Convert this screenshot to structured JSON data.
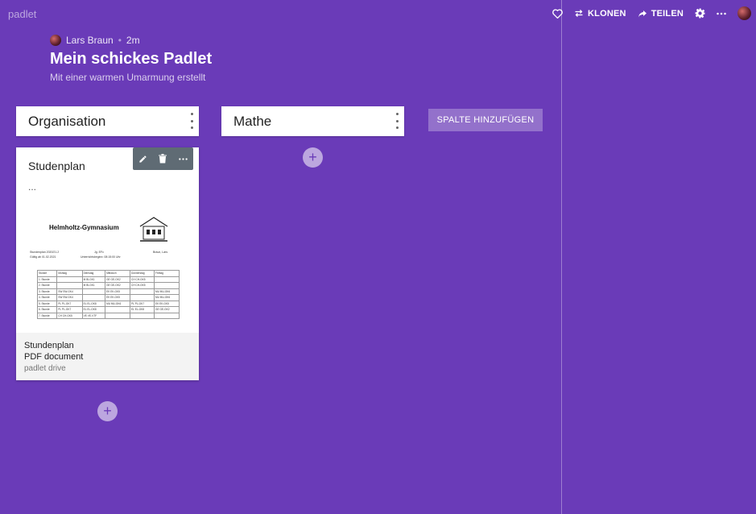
{
  "app": {
    "logo": "padlet"
  },
  "topbar": {
    "like_icon": "heart-icon",
    "clone_label": "KLONEN",
    "share_label": "TEILEN",
    "settings_icon": "gear-icon",
    "more_icon": "more-icon"
  },
  "padlet": {
    "author": "Lars Braun",
    "age": "2m",
    "title": "Mein schickes Padlet",
    "subtitle": "Mit einer warmen Umarmung erstellt"
  },
  "columns": [
    {
      "name": "Organisation"
    },
    {
      "name": "Mathe"
    }
  ],
  "add_column_label": "SPALTE HINZUFÜGEN",
  "card": {
    "title": "Studenplan",
    "body": "...",
    "attachment": {
      "name": "Stundenplan",
      "type": "PDF document",
      "source": "padlet drive"
    },
    "preview": {
      "school": "Helmholtz-Gymnasium",
      "line1": "Stundenplan  2020/21.2",
      "line2": "Gültig ab 01.02.2021",
      "grade": "Jg. EFc",
      "start": "Unterrichtsbeginn:  08:15:00 Uhr",
      "name": "Braun, Lars",
      "table_header": [
        "Stunde",
        "Montag",
        "Dienstag",
        "Mittwoch",
        "Donnerstag",
        "Freitag"
      ],
      "table_rows": [
        [
          "1. Stunde",
          "",
          "M  BI-GK1",
          "GE  GE-GK2",
          "CH  CH-GK5",
          ""
        ],
        [
          "2. Stunde",
          "",
          "M  BI-GK1",
          "GE  GE-GK2",
          "CH  CH-GK5",
          ""
        ],
        [
          "3. Stunde",
          "SW  SW-GK4",
          "",
          "EK  EK-GK5",
          "",
          "MU  MU-GK6"
        ],
        [
          "4. Stunde",
          "SW  SW-GK4",
          "",
          "EK  EK-GK5",
          "",
          "MU  MU-GK6"
        ],
        [
          "5. Stunde",
          "PL  PL-GK7",
          "EL  EL-GK8",
          "MU  MU-GK6",
          "PL  PL-GK7",
          "EK  EK-GK5"
        ],
        [
          "6. Stunde",
          "PL  PL-GK7",
          "EL  EL-GK8",
          "",
          "EL  EL-GK8",
          "GE  GE-GK2"
        ],
        [
          "7. Stunde",
          "CH  CH-GK5",
          "VE  VE-VTF",
          "",
          "",
          ""
        ]
      ]
    }
  }
}
